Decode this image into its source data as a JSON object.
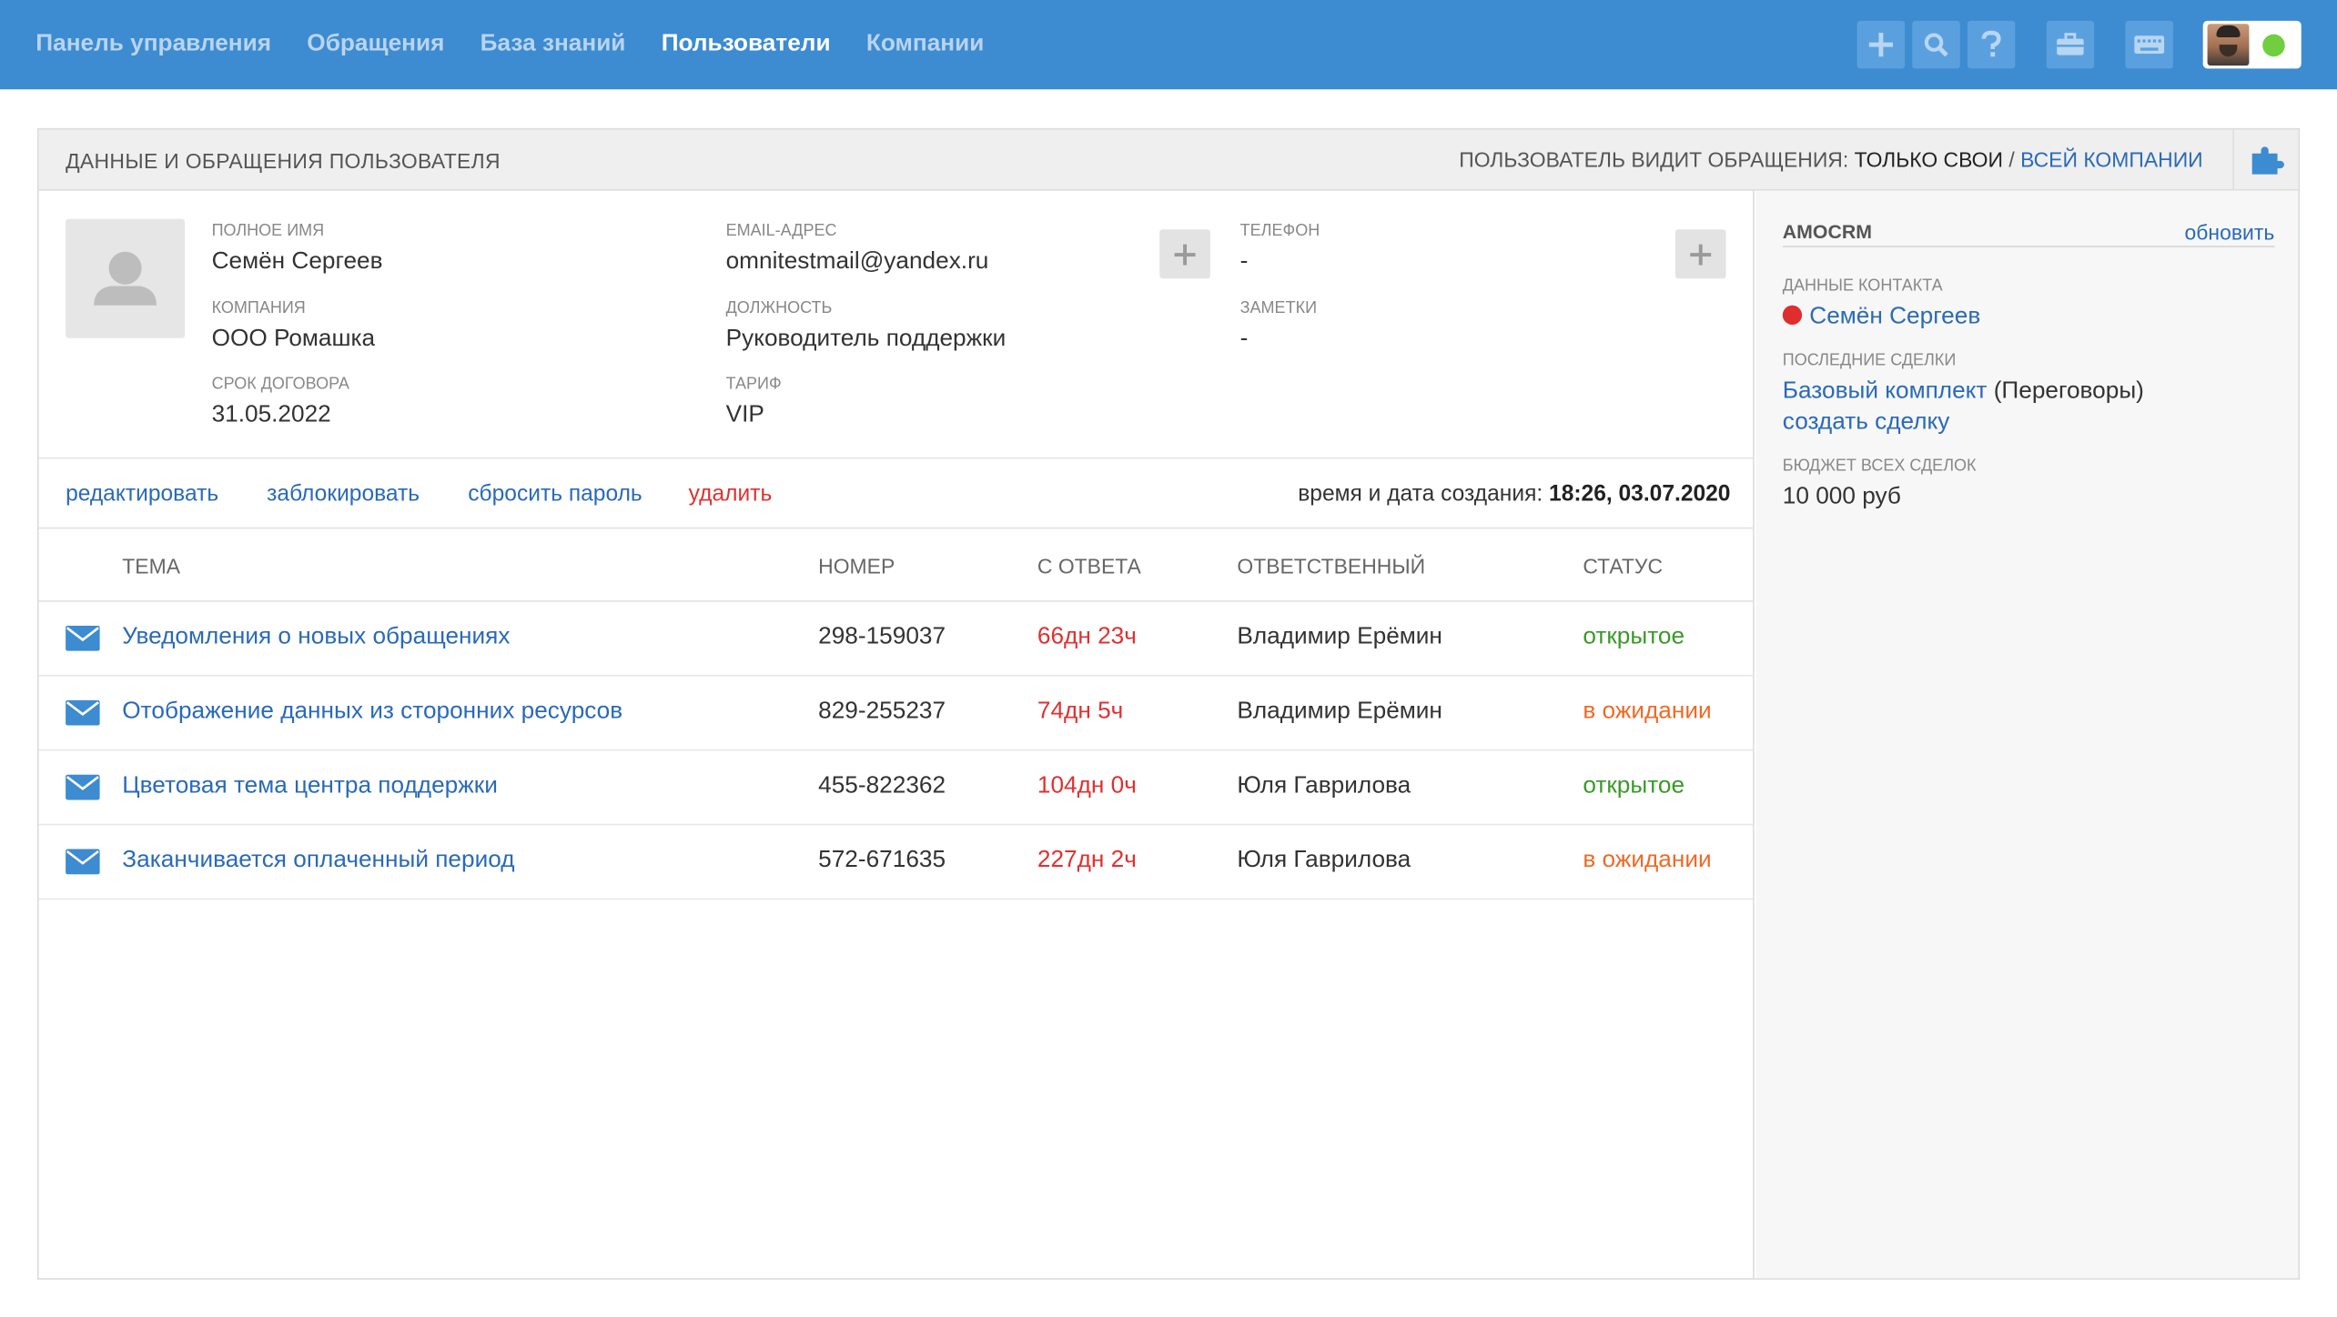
{
  "nav": {
    "items": [
      {
        "label": "Панель управления",
        "active": false
      },
      {
        "label": "Обращения",
        "active": false
      },
      {
        "label": "База знаний",
        "active": false
      },
      {
        "label": "Пользователи",
        "active": true
      },
      {
        "label": "Компании",
        "active": false
      }
    ]
  },
  "toolbar": {
    "icons": [
      "plus-icon",
      "search-icon",
      "help-icon",
      "briefcase-icon",
      "keyboard-icon"
    ],
    "user_status": "online"
  },
  "panel": {
    "title": "Данные и обращения пользователя",
    "visibility_prefix": "Пользователь видит обращения:",
    "visibility_current": "только свои",
    "visibility_sep": "/",
    "visibility_alt": "всей компании"
  },
  "user": {
    "fullname_label": "Полное имя",
    "fullname": "Семён Сергеев",
    "company_label": "Компания",
    "company": "ООО Ромашка",
    "contract_label": "Срок договора",
    "contract": "31.05.2022",
    "email_label": "Email-адрес",
    "email": "omnitestmail@yandex.ru",
    "position_label": "Должность",
    "position": "Руководитель поддержки",
    "tariff_label": "Тариф",
    "tariff": "VIP",
    "phone_label": "Телефон",
    "phone": "-",
    "notes_label": "Заметки",
    "notes": "-"
  },
  "actions": {
    "edit": "редактировать",
    "block": "заблокировать",
    "reset_password": "сбросить пароль",
    "delete": "удалить",
    "created_label": "время и дата создания:",
    "created_value": "18:26, 03.07.2020"
  },
  "table": {
    "headers": {
      "subject": "Тема",
      "number": "Номер",
      "since_reply": "С ответа",
      "assignee": "Ответственный",
      "status": "Статус"
    },
    "rows": [
      {
        "subject": "Уведомления о новых обращениях",
        "number": "298-159037",
        "since_reply": "66дн 23ч",
        "assignee": "Владимир Ерёмин",
        "status": "открытое",
        "status_type": "open"
      },
      {
        "subject": "Отображение данных из сторонних ресурсов",
        "number": "829-255237",
        "since_reply": "74дн 5ч",
        "assignee": "Владимир Ерёмин",
        "status": "в ожидании",
        "status_type": "wait"
      },
      {
        "subject": "Цветовая тема центра поддержки",
        "number": "455-822362",
        "since_reply": "104дн 0ч",
        "assignee": "Юля Гаврилова",
        "status": "открытое",
        "status_type": "open"
      },
      {
        "subject": "Заканчивается оплаченный период",
        "number": "572-671635",
        "since_reply": "227дн 2ч",
        "assignee": "Юля Гаврилова",
        "status": "в ожидании",
        "status_type": "wait"
      }
    ]
  },
  "sidebar": {
    "title": "AmoCRM",
    "refresh": "обновить",
    "contact_label": "Данные контакта",
    "contact_name": "Семён Сергеев",
    "deals_label": "Последние сделки",
    "deal_name": "Базовый комплект",
    "deal_stage": "(Переговоры)",
    "create_deal": "создать сделку",
    "budget_label": "Бюджет всех сделок",
    "budget_value": "10 000 руб"
  },
  "colors": {
    "topbar": "#3d8bd0",
    "link": "#2a6ab8",
    "danger": "#e03030",
    "status_open": "#3a9a2a",
    "status_wait": "#ee6a25",
    "online": "#6fcf3f"
  }
}
